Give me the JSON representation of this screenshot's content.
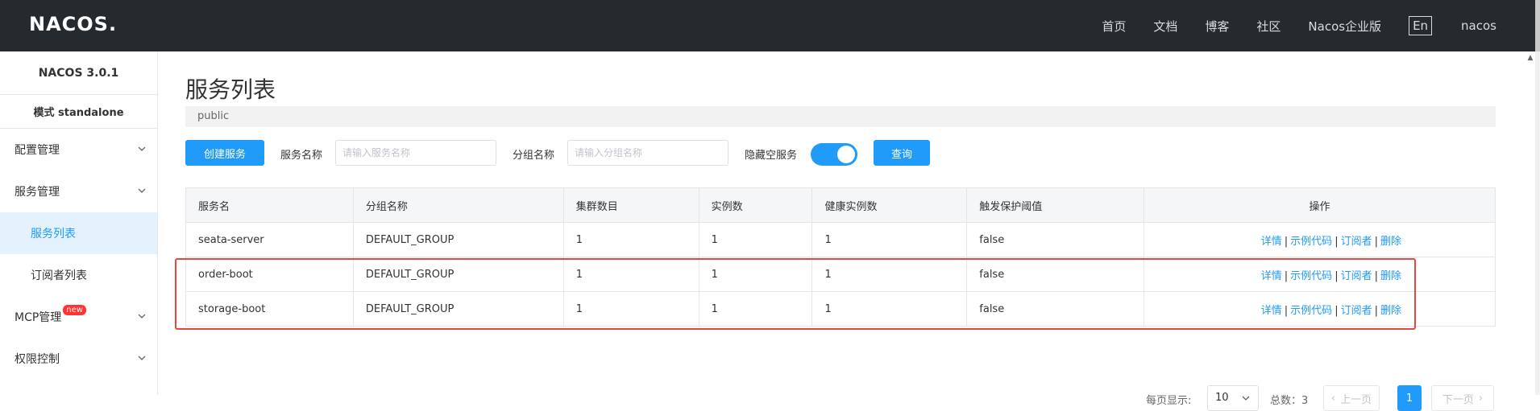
{
  "header": {
    "logo": "NACOS.",
    "nav": [
      "首页",
      "文档",
      "博客",
      "社区",
      "Nacos企业版"
    ],
    "lang": "En",
    "user": "nacos"
  },
  "sidebar": {
    "version": "NACOS 3.0.1",
    "mode": "模式 standalone",
    "items": [
      {
        "label": "配置管理"
      },
      {
        "label": "服务管理"
      },
      {
        "label": "服务列表"
      },
      {
        "label": "订阅者列表"
      },
      {
        "label": "MCP管理",
        "badge": "new"
      },
      {
        "label": "权限控制"
      }
    ]
  },
  "main": {
    "title": "服务列表",
    "namespace": "public",
    "filters": {
      "create_button": "创建服务",
      "service_name_label": "服务名称",
      "service_name_placeholder": "请输入服务名称",
      "group_name_label": "分组名称",
      "group_name_placeholder": "请输入分组名称",
      "hide_empty_label": "隐藏空服务",
      "hide_empty_on": true,
      "query_button": "查询"
    },
    "table": {
      "headers": [
        "服务名",
        "分组名称",
        "集群数目",
        "实例数",
        "健康实例数",
        "触发保护阈值",
        "操作"
      ],
      "rows": [
        [
          "seata-server",
          "DEFAULT_GROUP",
          "1",
          "1",
          "1",
          "false"
        ],
        [
          "order-boot",
          "DEFAULT_GROUP",
          "1",
          "1",
          "1",
          "false"
        ],
        [
          "storage-boot",
          "DEFAULT_GROUP",
          "1",
          "1",
          "1",
          "false"
        ]
      ],
      "actions": [
        "详情",
        "示例代码",
        "订阅者",
        "删除"
      ],
      "separator": "|"
    },
    "pagination": {
      "page_size_label": "每页显示:",
      "page_size": "10",
      "total_label": "总数：3",
      "prev": "上一页",
      "current": "1",
      "next": "下一页"
    }
  },
  "colors": {
    "topbar": "#252a2f",
    "primary": "#209bfa",
    "highlight": "#e8473d"
  }
}
